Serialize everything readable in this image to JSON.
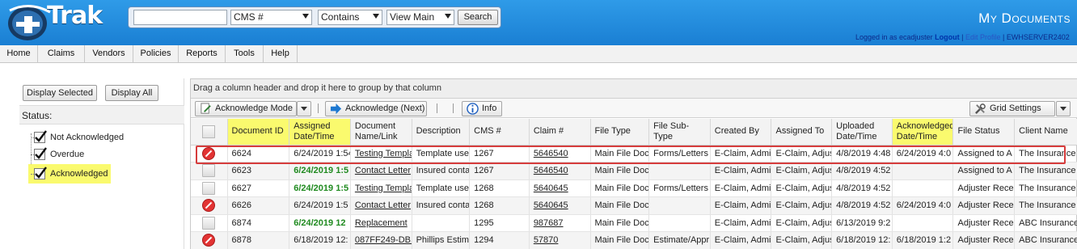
{
  "header": {
    "logo_text": "Trak",
    "page_title": "My Documents",
    "user_prefix": "Logged in as ecadjuster",
    "logout": "Logout",
    "edit_profile": "Edit Profile",
    "server": "EWHSERVER2402"
  },
  "search": {
    "input_value": "",
    "field_select": "CMS #",
    "operator_select": "Contains",
    "view_select": "View Main",
    "button": "Search"
  },
  "menu": [
    "Home",
    "Claims",
    "Vendors",
    "Policies",
    "Reports",
    "Tools",
    "Help"
  ],
  "left": {
    "display_selected": "Display Selected",
    "display_all": "Display All",
    "status_label": "Status:",
    "items": [
      "Not Acknowledged",
      "Overdue",
      "Acknowledged"
    ]
  },
  "grid": {
    "group_hint": "Drag a column header and drop it here to group by that column",
    "acknowledge_mode": "Acknowledge Mode",
    "acknowledge_next": "Acknowledge (Next)",
    "info": "Info",
    "grid_settings": "Grid Settings",
    "columns": [
      "",
      "Document ID",
      "Assigned Date/Time",
      "Document Name/Link",
      "Description",
      "CMS #",
      "Claim #",
      "File Type",
      "File Sub-Type",
      "Created By",
      "Assigned To",
      "Uploaded Date/Time",
      "Acknowledged Date/Time",
      "File Status",
      "Client Name"
    ],
    "rows": [
      {
        "icon": "no",
        "cells": [
          "6624",
          "6/24/2019 1:54",
          "Testing Template",
          "Template used",
          "1267",
          "5646540",
          "Main File Docu",
          "Forms/Letters",
          "E-Claim, Admi",
          "E-Claim, Adjus",
          "4/8/2019 4:48",
          "6/24/2019 4:0",
          "Assigned to A",
          "The Insurance"
        ],
        "assigned_green": false
      },
      {
        "icon": "box",
        "cells": [
          "6623",
          "6/24/2019 1:5",
          "Contact Letter",
          "Insured contac",
          "1267",
          "5646540",
          "Main File Docu",
          "",
          "E-Claim, Admi",
          "E-Claim, Adjus",
          "4/8/2019 4:52",
          "",
          "Assigned to A",
          "The Insurance"
        ],
        "assigned_green": true
      },
      {
        "icon": "box",
        "cells": [
          "6627",
          "6/24/2019 1:5",
          "Testing Templa",
          "Template usec",
          "1268",
          "5640645",
          "Main File Docu",
          "Forms/Letters",
          "E-Claim, Admi",
          "E-Claim, Adjus",
          "4/8/2019 4:52",
          "",
          "Adjuster Recei",
          "The Insurance"
        ],
        "assigned_green": true
      },
      {
        "icon": "no",
        "cells": [
          "6626",
          "6/24/2019 1:5",
          "Contact Letter",
          "Insured contac",
          "1268",
          "5640645",
          "Main File Docu",
          "",
          "E-Claim, Admi",
          "E-Claim, Adjus",
          "4/8/2019 4:52",
          "6/24/2019 4:0",
          "Adjuster Recei",
          "The Insurance"
        ],
        "assigned_green": false
      },
      {
        "icon": "box",
        "cells": [
          "6874",
          "6/24/2019 12",
          "Replacement",
          "",
          "1295",
          "987687",
          "Main File Docu",
          "",
          "E-Claim, Admi",
          "E-Claim, Adjus",
          "6/13/2019 9:2",
          "",
          "Adjuster Recei",
          "ABC Insurance"
        ],
        "assigned_green": true
      },
      {
        "icon": "no",
        "cells": [
          "6878",
          "6/18/2019 12:",
          "087FF249-DB1",
          "Phillips Estima",
          "1294",
          "57870",
          "Main File Docu",
          "Estimate/Appr",
          "E-Claim, Admi",
          "E-Claim, Adjus",
          "6/18/2019 12:",
          "6/18/2019 1:2",
          "Adjuster Recei",
          "ABC Insurance"
        ],
        "assigned_green": false
      }
    ]
  },
  "colors": {
    "header_blue": "#1a7fd3",
    "highlight_yellow": "#fafa6e",
    "selection_outline": "#d63c3c",
    "overdue_green": "#1f8a1f",
    "stop_red": "#e23333"
  }
}
